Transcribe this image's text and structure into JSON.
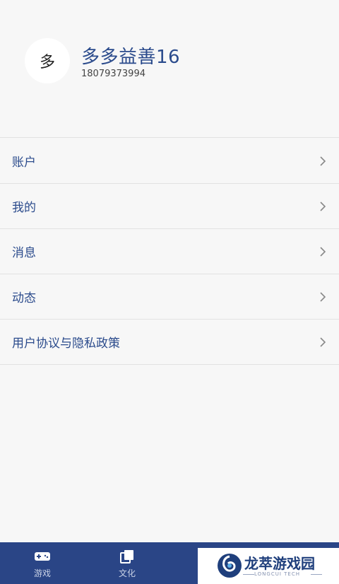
{
  "profile": {
    "avatar_text": "多",
    "name": "多多益善16",
    "phone": "18079373994"
  },
  "menu": {
    "items": [
      {
        "label": "账户"
      },
      {
        "label": "我的"
      },
      {
        "label": "消息"
      },
      {
        "label": "动态"
      },
      {
        "label": "用户协议与隐私政策"
      }
    ]
  },
  "tabbar": {
    "tabs": [
      {
        "label": "游戏",
        "icon": "gamepad-icon"
      },
      {
        "label": "文化",
        "icon": "cards-icon"
      }
    ]
  },
  "watermark": {
    "title": "龙萃游戏园",
    "subtitle": "LONGCUI TECH",
    "icon": "swirl-logo-icon"
  },
  "colors": {
    "accent": "#2b4b8c",
    "tabbar_bg": "#2a4586",
    "background": "#f7f7f7"
  }
}
